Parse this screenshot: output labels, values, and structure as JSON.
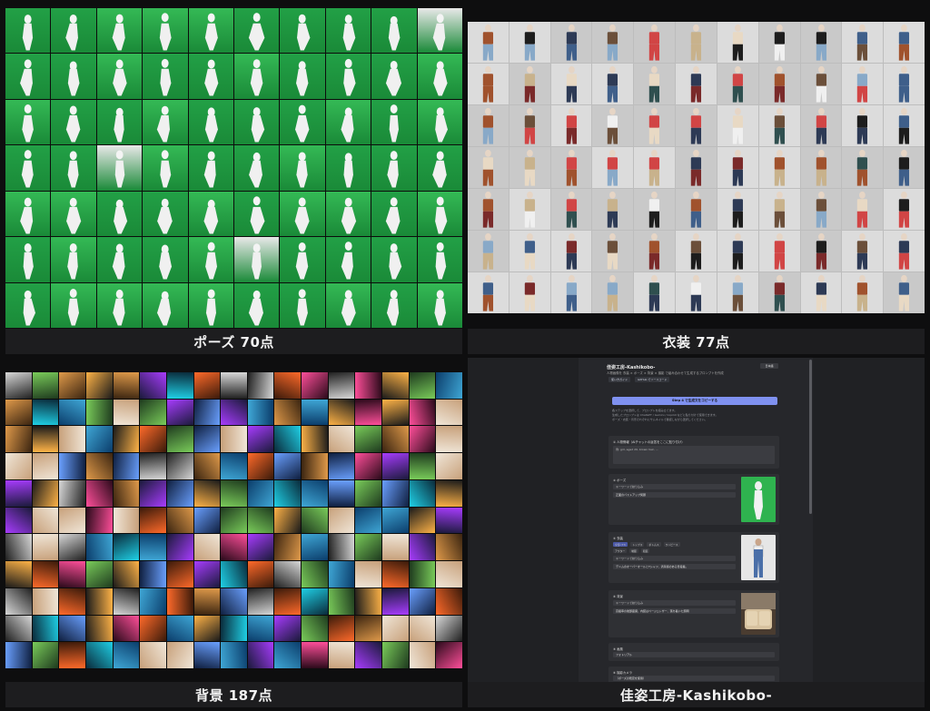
{
  "captions": {
    "poses": "ポーズ 70点",
    "costumes": "衣装 77点",
    "backgrounds": "背景 187点",
    "app": "佳姿工房-Kashikobo-"
  },
  "colors": {
    "pose_green": "#2fb34f",
    "pose_green_dark": "#1f8c3a",
    "caption_bg": "#1d1d1f",
    "accent": "#7f91f0"
  },
  "app": {
    "title": "佳姿工房-Kashikobo-",
    "subtitle": "人物画像を 衣装 × ポーズ × 背景 × 撮影 で組み合わせて生成するプロンプトを作成",
    "language": "日本語",
    "chips": [
      "使い方ガイド",
      "GitHub でソースコード"
    ],
    "copy_button": "Step 4 で生成文をコピーする",
    "description": [
      "各ステップを選択して、プロンプトを組み立てます。",
      "生成したプロンプトは ChatGPT / Gemini / Copilot などに貼り付けて使用できます。",
      "ポーズ・衣装・背景それぞれにサムネイルで確認しながら選択してください。"
    ],
    "sections": {
      "input_label": "① 人物情報（AIチャットの返答をここに貼り付け）",
      "input_placeholder": "例: girl, aged 20, brown hair, ...",
      "pose_label": "② ポーズ",
      "pose_placeholder": "キーワードで絞り込み",
      "pose_value": "正面のバストアップ笑顔",
      "costume_label": "③ 衣装",
      "costume_options": [
        "全部 (77)",
        "トップス",
        "ボトムス",
        "ワンピース",
        "アウター",
        "制服",
        "和装"
      ],
      "costume_placeholder": "キーワードで絞り込み",
      "costume_value": "デニムのオーバーオールとTシャツ、清潔感のある普段着。",
      "background_label": "④ 背景",
      "background_placeholder": "キーワードで絞り込み",
      "background_value": "高級車の後部座席、内装はベージュレザー、落ち着いた照明",
      "style_label": "⑤ 画風",
      "style_value": "フォトリアル",
      "camera_label": "⑥ 撮影カメラ",
      "camera_value": "（ポーズの既定を使用）"
    }
  }
}
